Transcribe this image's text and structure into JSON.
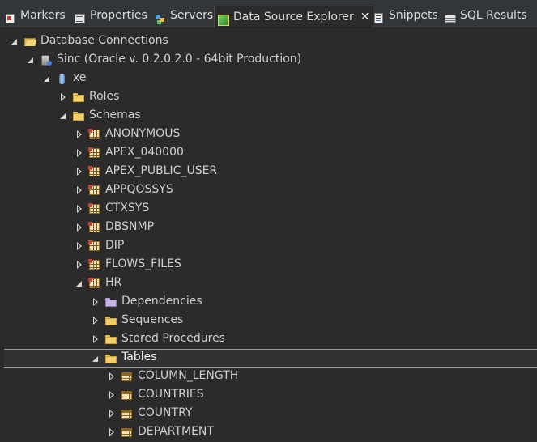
{
  "tabs": [
    {
      "label": "Markers",
      "icon": "markers-icon"
    },
    {
      "label": "Properties",
      "icon": "properties-icon"
    },
    {
      "label": "Servers",
      "icon": "servers-icon"
    },
    {
      "label": "Data Source Explorer",
      "icon": "data-source-explorer-icon",
      "active": true
    },
    {
      "label": "Snippets",
      "icon": "snippets-icon"
    },
    {
      "label": "SQL Results",
      "icon": "sql-results-icon"
    }
  ],
  "close_glyph": "✕",
  "tree": [
    {
      "label": "Database Connections",
      "icon": "folder-open-icon",
      "expanded": true
    },
    {
      "label": "Sinc (Oracle v. 0.2.0.2.0 - 64bit Production)",
      "icon": "connection-icon",
      "expanded": true
    },
    {
      "label": "xe",
      "icon": "database-icon",
      "expanded": true
    },
    {
      "label": "Roles",
      "icon": "folder-icon",
      "expanded": false
    },
    {
      "label": "Schemas",
      "icon": "folder-icon",
      "expanded": true
    },
    {
      "label": "ANONYMOUS",
      "icon": "schema-icon",
      "expanded": false
    },
    {
      "label": "APEX_040000",
      "icon": "schema-icon",
      "expanded": false
    },
    {
      "label": "APEX_PUBLIC_USER",
      "icon": "schema-icon",
      "expanded": false
    },
    {
      "label": "APPQOSSYS",
      "icon": "schema-icon",
      "expanded": false
    },
    {
      "label": "CTXSYS",
      "icon": "schema-icon",
      "expanded": false
    },
    {
      "label": "DBSNMP",
      "icon": "schema-icon",
      "expanded": false
    },
    {
      "label": "DIP",
      "icon": "schema-icon",
      "expanded": false
    },
    {
      "label": "FLOWS_FILES",
      "icon": "schema-icon",
      "expanded": false
    },
    {
      "label": "HR",
      "icon": "schema-icon",
      "expanded": true
    },
    {
      "label": "Dependencies",
      "icon": "folder-icon",
      "expanded": false
    },
    {
      "label": "Sequences",
      "icon": "folder-icon",
      "expanded": false
    },
    {
      "label": "Stored Procedures",
      "icon": "folder-icon",
      "expanded": false
    },
    {
      "label": "Tables",
      "icon": "folder-icon",
      "expanded": true,
      "selected": true
    },
    {
      "label": "COLUMN_LENGTH",
      "icon": "table-icon",
      "expanded": false
    },
    {
      "label": "COUNTRIES",
      "icon": "table-icon",
      "expanded": false
    },
    {
      "label": "COUNTRY",
      "icon": "table-icon",
      "expanded": false
    },
    {
      "label": "DEPARTMENT",
      "icon": "table-icon",
      "expanded": false
    }
  ]
}
